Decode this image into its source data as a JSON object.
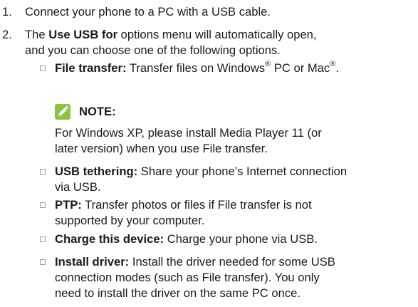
{
  "steps": [
    {
      "num": "1.",
      "text": "Connect your phone to a PC with a USB cable."
    },
    {
      "num": "2.",
      "pre": "The ",
      "bold": "Use USB for",
      "post_line1": " options menu will automatically open,",
      "line2": "and you can choose one of the following options."
    }
  ],
  "options": [
    {
      "label": "File transfer:",
      "text_a": " Transfer files on Windows",
      "sup_a": "®",
      "text_b": " PC or Mac",
      "sup_b": "®",
      "text_c": "."
    },
    {
      "label": "USB tethering:",
      "line1": " Share your phone’s Internet connection",
      "line2": "via USB."
    },
    {
      "label": "PTP:",
      "line1": " Transfer photos or files if File transfer is not",
      "line2": "supported by your computer."
    },
    {
      "label": "Charge this device:",
      "line1": " Charge your phone via USB."
    },
    {
      "label": "Install driver:",
      "line1": " Install the driver needed for some USB",
      "line2": "connection modes (such as File transfer). You only",
      "line3": "need to install the driver on the same PC once."
    }
  ],
  "note": {
    "icon": "pencil-note-icon",
    "icon_color": "#8bc540",
    "label": "NOTE:",
    "line1": "For Windows XP, please install Media Player 11 (or",
    "line2": "later version) when you use File transfer."
  }
}
